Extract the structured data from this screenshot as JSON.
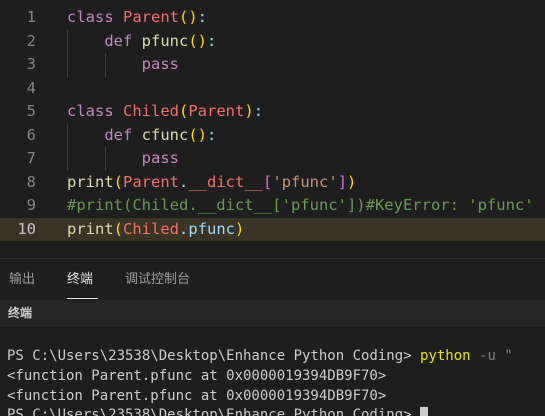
{
  "editor": {
    "lines": [
      {
        "num": "1",
        "tokens": [
          [
            "kw-class",
            "class "
          ],
          [
            "name",
            "Parent"
          ],
          [
            "paren1",
            "()"
          ],
          [
            "plain",
            ":"
          ]
        ]
      },
      {
        "num": "2",
        "tokens": [
          [
            "plain",
            "    "
          ],
          [
            "kw-def",
            "def "
          ],
          [
            "fn",
            "pfunc"
          ],
          [
            "paren1",
            "()"
          ],
          [
            "plain",
            ":"
          ]
        ]
      },
      {
        "num": "3",
        "tokens": [
          [
            "plain",
            "        "
          ],
          [
            "kw-pass",
            "pass"
          ]
        ]
      },
      {
        "num": "4",
        "tokens": []
      },
      {
        "num": "5",
        "tokens": [
          [
            "kw-class",
            "class "
          ],
          [
            "name",
            "Chiled"
          ],
          [
            "paren1",
            "("
          ],
          [
            "name",
            "Parent"
          ],
          [
            "paren1",
            ")"
          ],
          [
            "plain",
            ":"
          ]
        ]
      },
      {
        "num": "6",
        "tokens": [
          [
            "plain",
            "    "
          ],
          [
            "kw-def",
            "def "
          ],
          [
            "fn",
            "cfunc"
          ],
          [
            "paren1",
            "()"
          ],
          [
            "plain",
            ":"
          ]
        ]
      },
      {
        "num": "7",
        "tokens": [
          [
            "plain",
            "        "
          ],
          [
            "kw-pass",
            "pass"
          ]
        ]
      },
      {
        "num": "8",
        "tokens": [
          [
            "builtin",
            "print"
          ],
          [
            "paren1",
            "("
          ],
          [
            "name",
            "Parent"
          ],
          [
            "plain",
            "."
          ],
          [
            "dunder",
            "__dict__"
          ],
          [
            "paren2",
            "["
          ],
          [
            "str",
            "'pfunc'"
          ],
          [
            "paren2",
            "]"
          ],
          [
            "paren1",
            ")"
          ]
        ]
      },
      {
        "num": "9",
        "tokens": [
          [
            "cmt",
            "#print(Chiled.__dict__['pfunc'])#KeyError: 'pfunc'"
          ]
        ]
      },
      {
        "num": "10",
        "tokens": [
          [
            "builtin",
            "print"
          ],
          [
            "paren1",
            "("
          ],
          [
            "name",
            "Chiled"
          ],
          [
            "plain",
            "."
          ],
          [
            "plain",
            "pfunc"
          ],
          [
            "paren1",
            ")"
          ]
        ]
      }
    ]
  },
  "panel": {
    "tabs": [
      "输出",
      "终端",
      "调试控制台"
    ],
    "active_tab": "终端",
    "terminal_title": "终端"
  },
  "terminal": {
    "line1_prompt": "PS C:\\Users\\23538\\Desktop\\Enhance Python Coding> ",
    "line1_cmd": "python",
    "line1_flag": " -u \"",
    "line2": "<function Parent.pfunc at 0x0000019394DB9F70>",
    "line3": "<function Parent.pfunc at 0x0000019394DB9F70>",
    "line4_prompt": "PS C:\\Users\\23538\\Desktop\\Enhance Python Coding> "
  },
  "colors": {
    "background": "#1e1e1e",
    "keyword": "#c586c0",
    "class_name": "#f47067",
    "function": "#dcdcaa",
    "string": "#ce9178",
    "comment": "#6a9955",
    "current_line": "#3a3426"
  }
}
